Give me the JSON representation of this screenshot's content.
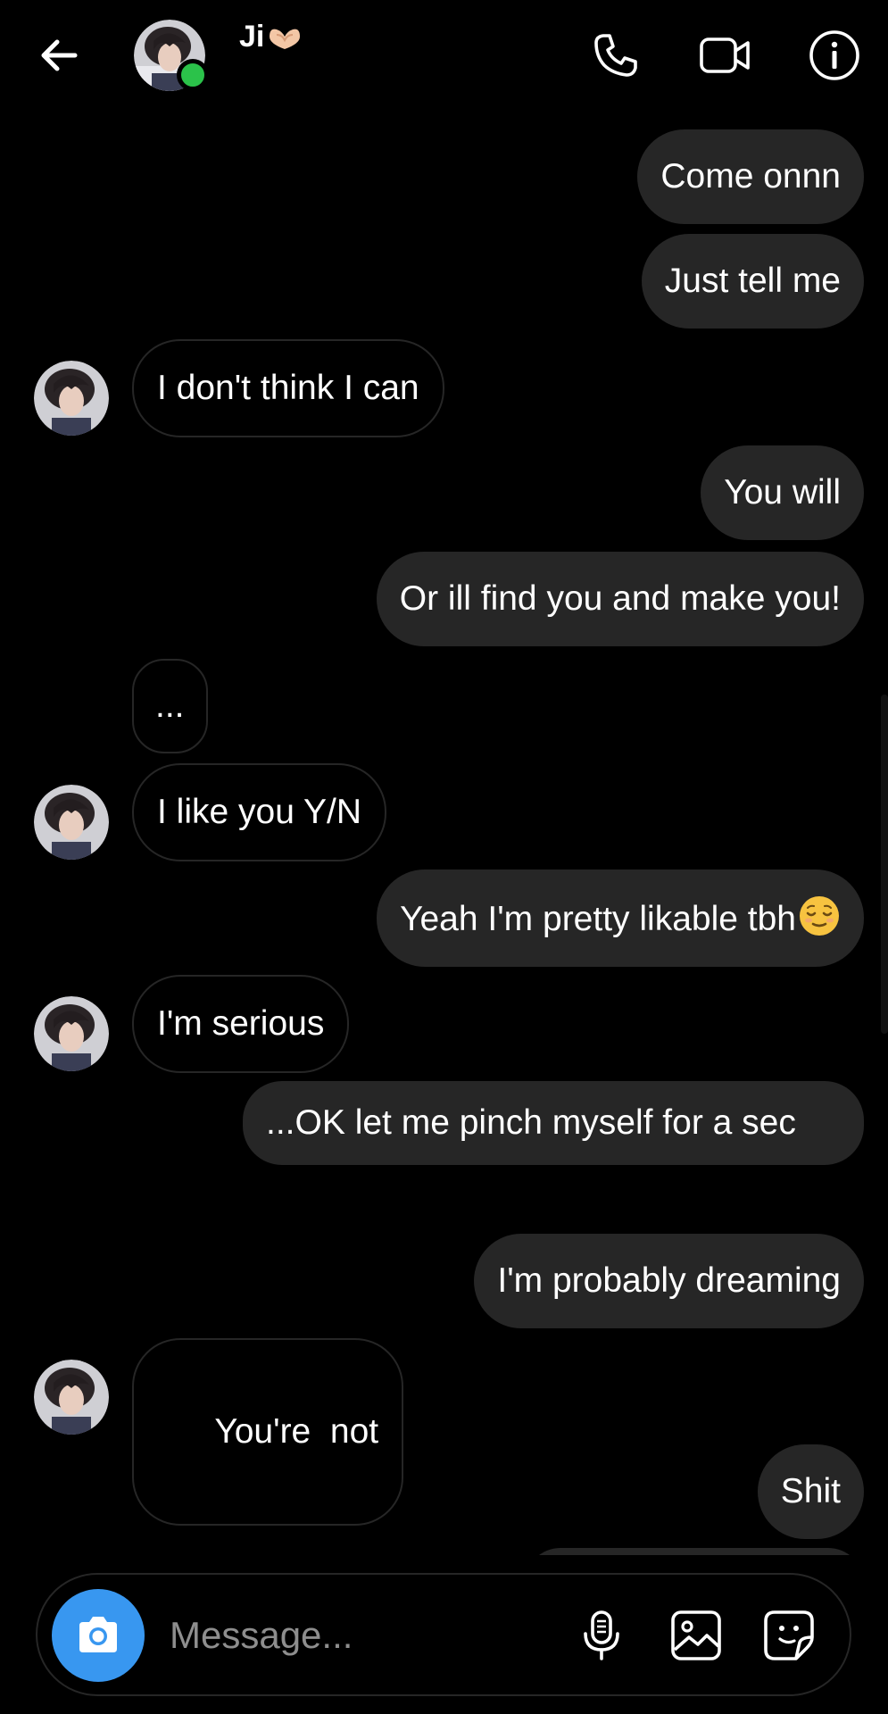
{
  "header": {
    "contact_name": "Ji",
    "icons": {
      "back": "arrow-left-icon",
      "call": "phone-icon",
      "video": "video-camera-icon",
      "info": "info-icon"
    },
    "online": true
  },
  "messages": [
    {
      "from": "me",
      "text": "Come onnn"
    },
    {
      "from": "me",
      "text": "Just tell me"
    },
    {
      "from": "them",
      "text": "I don't think I can",
      "avatar": true
    },
    {
      "from": "me",
      "text": "You will"
    },
    {
      "from": "me",
      "text": "Or ill find you and make you!"
    },
    {
      "from": "them",
      "text": "...",
      "avatar": false
    },
    {
      "from": "them",
      "text": "I like you Y/N",
      "avatar": true
    },
    {
      "from": "me",
      "text": "Yeah I'm pretty likable tbh",
      "emoji": "relieved-face"
    },
    {
      "from": "them",
      "text": "I'm serious",
      "avatar": true
    },
    {
      "from": "me",
      "text": "...OK let me pinch myself for a sec"
    },
    {
      "from": "me",
      "text": "I'm probably dreaming"
    },
    {
      "from": "them",
      "text": "You're  not",
      "avatar": true
    },
    {
      "from": "me",
      "text": "Shit"
    }
  ],
  "composer": {
    "placeholder": "Message...",
    "icons": {
      "camera": "camera-icon",
      "mic": "microphone-icon",
      "gallery": "image-icon",
      "sticker": "sticker-icon"
    },
    "accent_color": "#3897f0"
  },
  "colors": {
    "background": "#000000",
    "outgoing_bubble": "#262626",
    "incoming_border": "#262626",
    "online": "#2bc24a"
  }
}
